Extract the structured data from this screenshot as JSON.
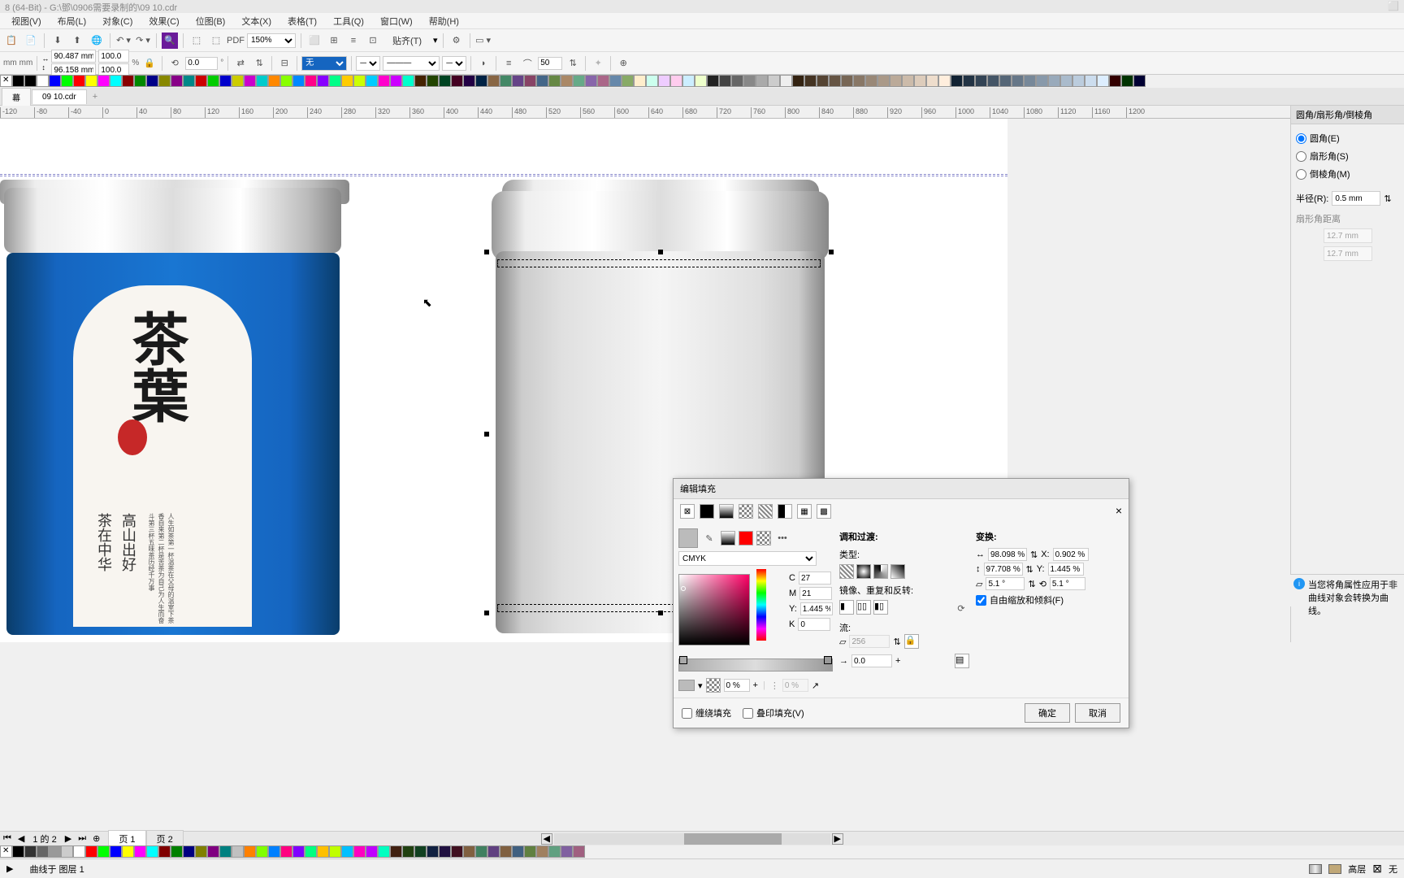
{
  "title_bar": "8 (64-Bit) - G:\\鄧\\0906需要录制的\\09 10.cdr",
  "menu": [
    "视图(V)",
    "布局(L)",
    "对象(C)",
    "效果(C)",
    "位图(B)",
    "文本(X)",
    "表格(T)",
    "工具(Q)",
    "窗口(W)",
    "帮助(H)"
  ],
  "toolbar": {
    "zoom": "150%",
    "snap": "贴齐(T)"
  },
  "prop": {
    "unit": "mm",
    "x": "90.487 mm",
    "y": "96.158 mm",
    "sx": "100.0",
    "sy": "100.0",
    "angle": "0.0",
    "outline_none": "无",
    "outline_width": "50"
  },
  "doc_tabs": {
    "tab1": "幕",
    "tab2": "09 10.cdr"
  },
  "ruler_marks": [
    "-120",
    "-80",
    "-40",
    "0",
    "40",
    "80",
    "120",
    "160",
    "200",
    "240",
    "280",
    "320",
    "360",
    "400",
    "440",
    "480",
    "520",
    "560",
    "600",
    "640",
    "680",
    "720",
    "760",
    "800",
    "840",
    "880",
    "920",
    "960",
    "1000",
    "1040",
    "1080",
    "1120",
    "1160",
    "1200"
  ],
  "docker": {
    "title": "圆角/扇形角/倒棱角",
    "opt1": "圆角(E)",
    "opt2": "扇形角(S)",
    "opt3": "倒棱角(M)",
    "radius_label": "半径(R):",
    "radius_val": "0.5 mm",
    "scallop_label": "扇形角距离",
    "dist1": "12.7 mm",
    "dist2": "12.7 mm"
  },
  "dialog": {
    "title": "编辑填充",
    "close_x": "×",
    "color_model": "CMYK",
    "c_label": "C",
    "c_val": "27",
    "m_label": "M",
    "m_val": "21",
    "y_label": "Y:",
    "y_val": "1.445 %",
    "k_label": "K",
    "k_val": "0",
    "blend_title": "调和过渡:",
    "type_label": "类型:",
    "mirror_label": "镜像、重复和反转:",
    "flow_label": "流:",
    "flow_val": "256",
    "transform_title": "变换:",
    "w_val": "98.098 %",
    "x_label": "X:",
    "x_val": "0.902 %",
    "h_val": "97.708 %",
    "skew1": "5.1 °",
    "skew2": "5.1 °",
    "free_scale": "自由缩放和倾斜(F)",
    "offset_val": "0.0",
    "opacity1": "0 %",
    "opacity2": "0 %",
    "wrap_fill": "缠绕填充",
    "overprint": "叠印填充(V)",
    "ok": "确定",
    "cancel": "取消"
  },
  "bottom": {
    "page_info": "1 的 2",
    "page1": "页 1",
    "page2": "页 2"
  },
  "status": {
    "text": "曲线于 图层 1",
    "fill_label": "无",
    "outline_label": "高层"
  },
  "hint": "当您将角属性应用于非曲线对象会转换为曲线。",
  "colors_top": [
    "#000",
    "#fff",
    "#00f",
    "#0f0",
    "#f00",
    "#ff0",
    "#f0f",
    "#0ff",
    "#800",
    "#080",
    "#008",
    "#880",
    "#808",
    "#088",
    "#c00",
    "#0c0",
    "#00c",
    "#cc0",
    "#c0c",
    "#0cc",
    "#f80",
    "#8f0",
    "#08f",
    "#f08",
    "#80f",
    "#0f8",
    "#fc0",
    "#cf0",
    "#0cf",
    "#f0c",
    "#c0f",
    "#0fc",
    "#420",
    "#240",
    "#042",
    "#402",
    "#204",
    "#024",
    "#864",
    "#486",
    "#648",
    "#846",
    "#468",
    "#684",
    "#a86",
    "#6a8",
    "#86a",
    "#a68",
    "#68a",
    "#8a6",
    "#fec",
    "#cfe",
    "#ecf",
    "#fce",
    "#cef",
    "#efc",
    "#222",
    "#444",
    "#666",
    "#888",
    "#aaa",
    "#ccc",
    "#eee",
    "#321",
    "#432",
    "#543",
    "#654",
    "#765",
    "#876",
    "#987",
    "#a98",
    "#ba9",
    "#cba",
    "#dcb",
    "#edc",
    "#fed",
    "#123",
    "#234",
    "#345",
    "#456",
    "#567",
    "#678",
    "#789",
    "#89a",
    "#9ab",
    "#abc",
    "#bcd",
    "#cde",
    "#def",
    "#300",
    "#030",
    "#003"
  ],
  "colors_bottom": [
    "#000",
    "#333",
    "#666",
    "#999",
    "#ccc",
    "#fff",
    "#f00",
    "#0f0",
    "#00f",
    "#ff0",
    "#f0f",
    "#0ff",
    "#800000",
    "#008000",
    "#000080",
    "#808000",
    "#800080",
    "#008080",
    "#c0c0c0",
    "#ff8000",
    "#80ff00",
    "#0080ff",
    "#ff0080",
    "#8000ff",
    "#00ff80",
    "#ffc000",
    "#c0ff00",
    "#00c0ff",
    "#ff00c0",
    "#c000ff",
    "#00ffc0",
    "#402010",
    "#204010",
    "#104020",
    "#102040",
    "#201040",
    "#401020",
    "#806040",
    "#408060",
    "#604080",
    "#806040",
    "#406080",
    "#608040",
    "#a08060",
    "#60a080",
    "#8060a0",
    "#a06080"
  ]
}
